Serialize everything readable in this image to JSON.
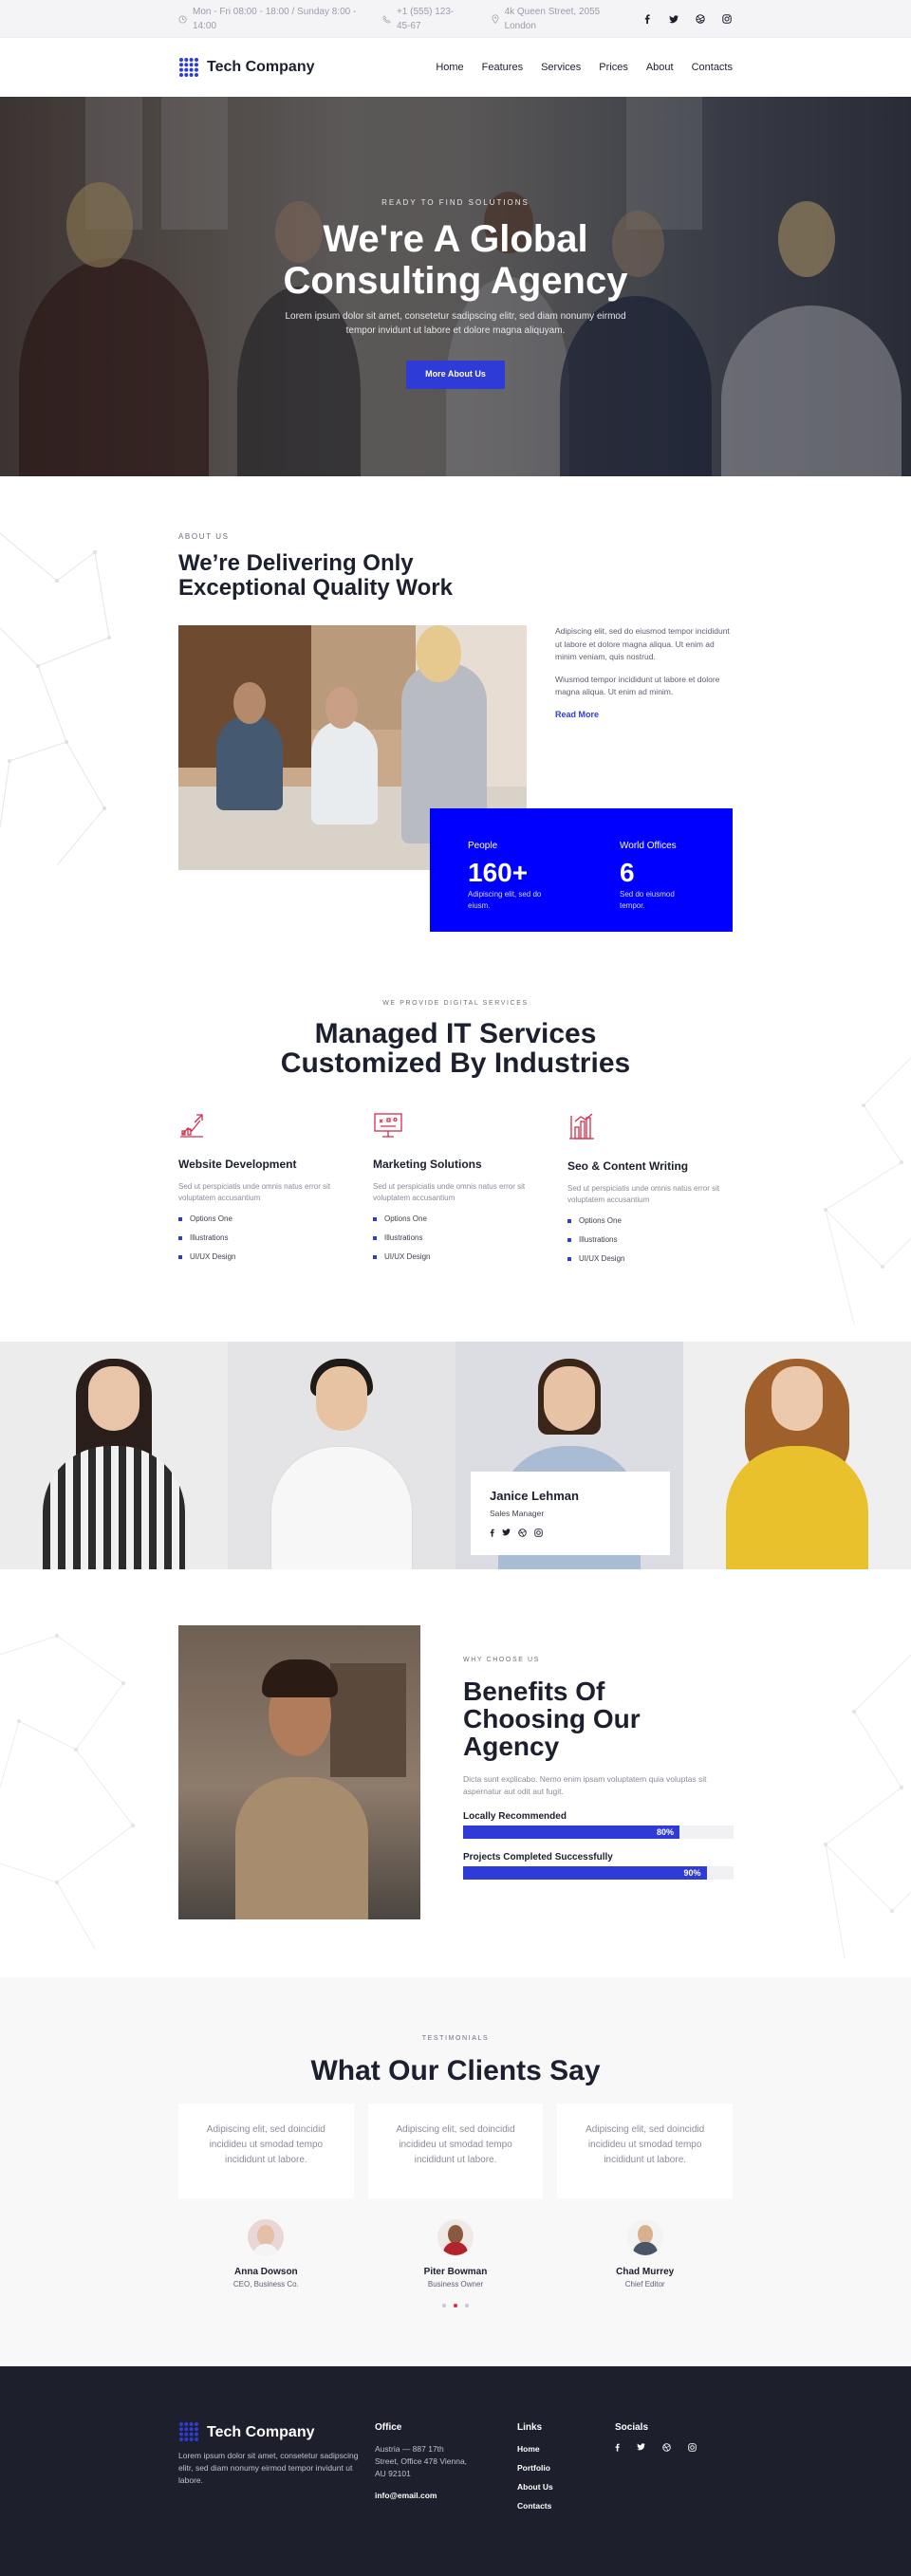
{
  "topbar": {
    "hours": "Mon - Fri 08:00 - 18:00 / Sunday 8:00 - 14:00",
    "phone": "+1 (555) 123-45-67",
    "address": "4k Queen Street, 2055 London"
  },
  "brand": {
    "name": "Tech Company",
    "accent": "#2f3bd6"
  },
  "nav": {
    "items": [
      "Home",
      "Features",
      "Services",
      "Prices",
      "About",
      "Contacts"
    ]
  },
  "hero": {
    "eyebrow": "READY TO FIND SOLUTIONS",
    "title_line1": "We're A Global",
    "title_line2": "Consulting Agency",
    "text": "Lorem ipsum dolor sit amet, consetetur sadipscing elitr, sed diam nonumy eirmod tempor invidunt ut labore et dolore magna aliquyam.",
    "cta": "More About Us"
  },
  "about": {
    "eyebrow": "ABOUT US",
    "title": "We’re Delivering Only Exceptional Quality Work",
    "para1": "Adipiscing elit, sed do eiusmod tempor incididunt ut labore et dolore magna aliqua. Ut enim ad minim veniam, quis nostrud.",
    "para2": "Wiusmod tempor incididunt ut labore et dolore magna aliqua. Ut enim ad minim.",
    "read_more": "Read More",
    "stats": [
      {
        "label": "People",
        "value": "160+",
        "sub": "Adipiscing elit, sed do eiusm."
      },
      {
        "label": "World Offices",
        "value": "6",
        "sub": "Sed do eiusmod tempor."
      }
    ]
  },
  "services": {
    "eyebrow": "WE PROVIDE DIGITAL SERVICES",
    "title_line1": "Managed IT Services",
    "title_line2": "Customized By Industries",
    "items": [
      {
        "icon": "rocket-chart-icon",
        "title": "Website Development",
        "desc": "Sed ut perspiciatis unde omnis natus error sit voluptatem accusantium",
        "bullets": [
          "Options One",
          "Illustrations",
          "UI/UX Design"
        ]
      },
      {
        "icon": "presentation-board-icon",
        "title": "Marketing Solutions",
        "desc": "Sed ut perspiciatis unde omnis natus error sit voluptatem accusantium",
        "bullets": [
          "Options One",
          "Illustrations",
          "UI/UX Design"
        ]
      },
      {
        "icon": "bar-chart-icon",
        "title": "Seo & Content Writing",
        "desc": "Sed ut perspiciatis unde omnis natus error sit voluptatem accusantium",
        "bullets": [
          "Options One",
          "Illustrations",
          "UI/UX Design"
        ]
      }
    ]
  },
  "team": {
    "featured": {
      "name": "Janice Lehman",
      "role": "Sales Manager"
    }
  },
  "benefits": {
    "eyebrow": "WHY CHOOSE US",
    "title": "Benefits Of Choosing Our Agency",
    "desc": "Dicta sunt explicabo. Nemo enim ipsam voluptatem quia voluptas sit aspernatur aut odit aut fugit.",
    "skills": [
      {
        "label": "Locally Recommended",
        "value_text": "80%",
        "value": 80
      },
      {
        "label": "Projects Completed Successfully",
        "value_text": "90%",
        "value": 90
      }
    ]
  },
  "testimonials": {
    "eyebrow": "TESTIMONIALS",
    "title": "What Our Clients Say",
    "items": [
      {
        "quote": "Adipiscing elit, sed doincidid incididеu ut smodad tempo incididunt ut labore.",
        "name": "Anna Dowson",
        "role": "CEO, Business Co."
      },
      {
        "quote": "Adipiscing elit, sed doincidid incididеu ut smodad tempo incididunt ut labore.",
        "name": "Piter Bowman",
        "role": "Business Owner"
      },
      {
        "quote": "Adipiscing elit, sed doincidid incididеu ut smodad tempo incididunt ut labore.",
        "name": "Chad Murrey",
        "role": "Chief Editor"
      }
    ]
  },
  "footer": {
    "about": "Lorem ipsum dolor sit amet, consetetur sadipscing elitr, sed diam nonumy eirmod tempor invidunt ut labore.",
    "office_title": "Office",
    "office_address": "Austria — 887 17th Street, Office 478 Vienna, AU 92101",
    "email": "info@email.com",
    "links_title": "Links",
    "links": [
      "Home",
      "Portfolio",
      "About Us",
      "Contacts"
    ],
    "socials_title": "Socials"
  }
}
